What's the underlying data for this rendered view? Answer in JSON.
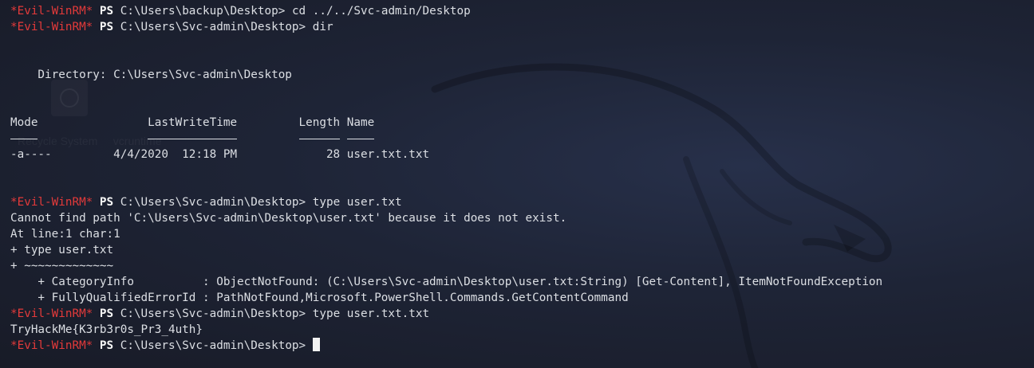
{
  "prompt": {
    "tag": "*Evil-WinRM*",
    "ps": "PS"
  },
  "ghost": {
    "labels": "Recycle System     vcruntime"
  },
  "lines": [
    {
      "type": "prompt",
      "path": "C:\\Users\\backup\\Desktop>",
      "cmd": "cd ../../Svc-admin/Desktop"
    },
    {
      "type": "prompt",
      "path": "C:\\Users\\Svc-admin\\Desktop>",
      "cmd": "dir"
    },
    {
      "type": "blank"
    },
    {
      "type": "blank"
    },
    {
      "type": "text",
      "text": "    Directory: C:\\Users\\Svc-admin\\Desktop"
    },
    {
      "type": "blank"
    },
    {
      "type": "blank"
    },
    {
      "type": "text",
      "text": "Mode                LastWriteTime         Length Name"
    },
    {
      "type": "underline",
      "widths": [
        4,
        13,
        6,
        4
      ],
      "gaps": [
        16,
        9,
        1
      ]
    },
    {
      "type": "text",
      "text": "-a----         4/4/2020  12:18 PM             28 user.txt.txt"
    },
    {
      "type": "blank"
    },
    {
      "type": "blank"
    },
    {
      "type": "prompt",
      "path": "C:\\Users\\Svc-admin\\Desktop>",
      "cmd": "type user.txt"
    },
    {
      "type": "text",
      "text": "Cannot find path 'C:\\Users\\Svc-admin\\Desktop\\user.txt' because it does not exist."
    },
    {
      "type": "text",
      "text": "At line:1 char:1"
    },
    {
      "type": "text",
      "text": "+ type user.txt"
    },
    {
      "type": "text",
      "text": "+ ~~~~~~~~~~~~~"
    },
    {
      "type": "text",
      "text": "    + CategoryInfo          : ObjectNotFound: (C:\\Users\\Svc-admin\\Desktop\\user.txt:String) [Get-Content], ItemNotFoundException"
    },
    {
      "type": "text",
      "text": "    + FullyQualifiedErrorId : PathNotFound,Microsoft.PowerShell.Commands.GetContentCommand"
    },
    {
      "type": "prompt",
      "path": "C:\\Users\\Svc-admin\\Desktop>",
      "cmd": "type user.txt.txt"
    },
    {
      "type": "text",
      "text": "TryHackMe{K3rb3r0s_Pr3_4uth}"
    },
    {
      "type": "prompt",
      "path": "C:\\Users\\Svc-admin\\Desktop>",
      "cmd": "",
      "cursor": true
    }
  ]
}
